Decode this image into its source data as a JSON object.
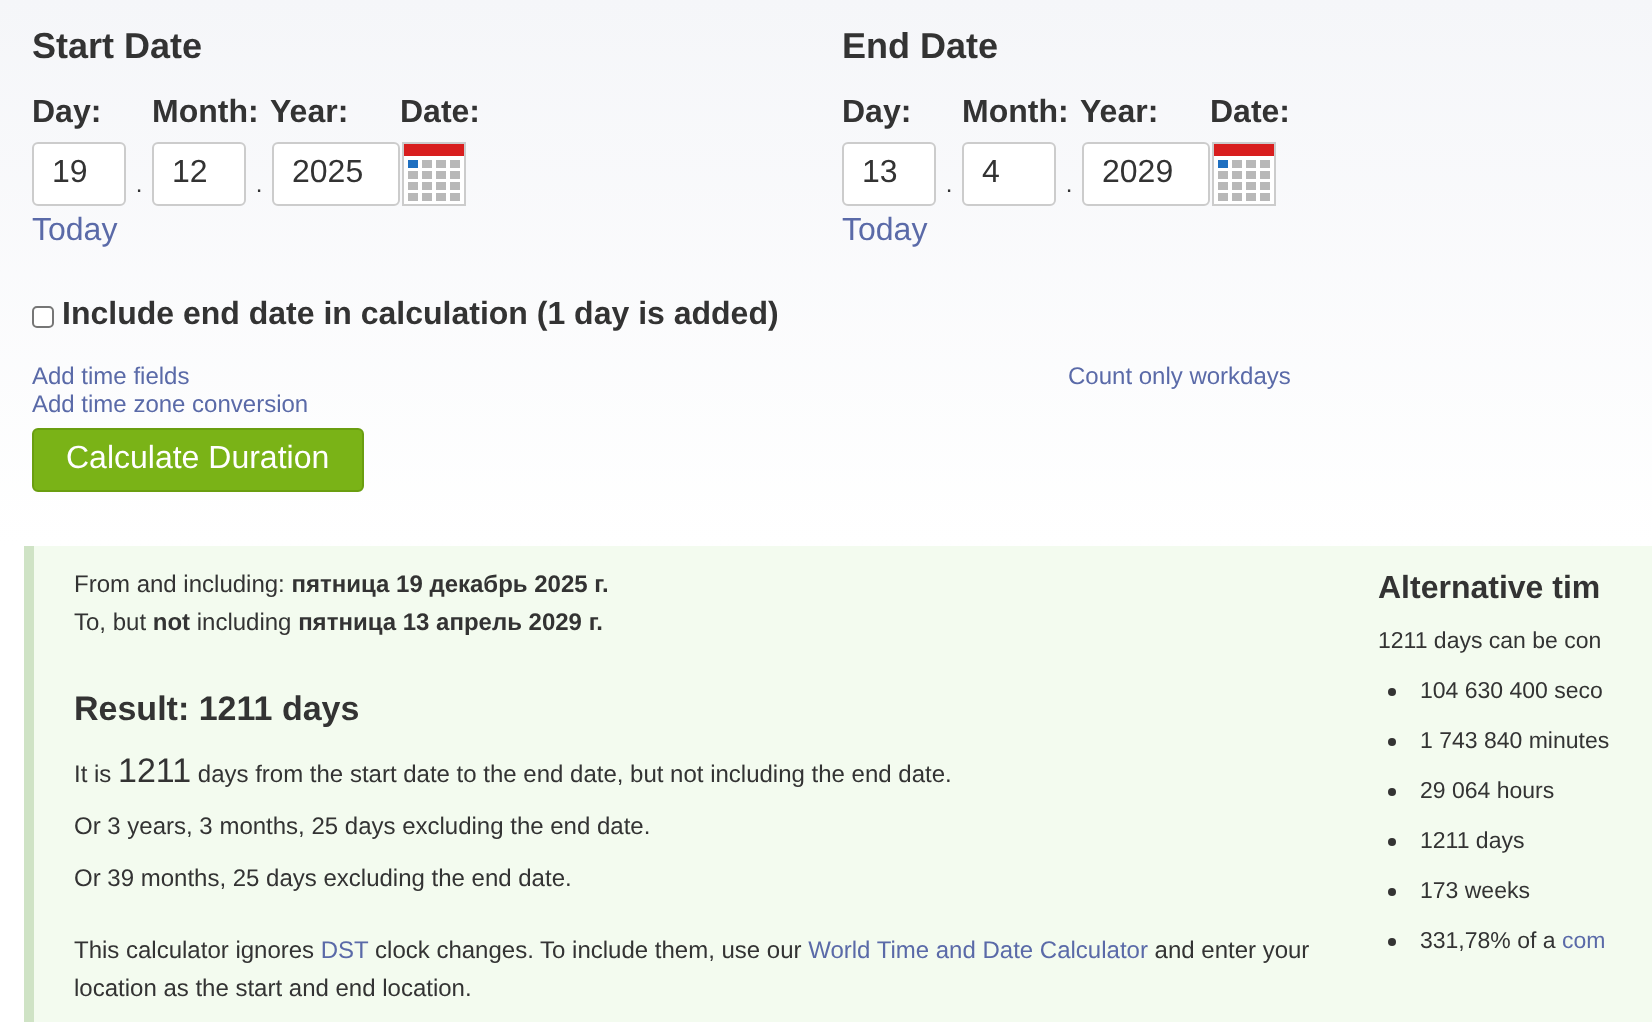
{
  "date_panels": [
    {
      "title": "Start Date",
      "labels": [
        "Day:",
        "Month:",
        "Year:",
        "Date:"
      ],
      "day": "19",
      "month": "12",
      "year": "2025",
      "separator": ".",
      "today_link": "Today"
    },
    {
      "title": "End Date",
      "labels": [
        "Day:",
        "Month:",
        "Year:",
        "Date:"
      ],
      "day": "13",
      "month": "4",
      "year": "2029",
      "separator": ".",
      "today_link": "Today"
    }
  ],
  "include_end_date": {
    "label": "Include end date in calculation (1 day is added)",
    "checked": false
  },
  "left_links": [
    "Add time fields",
    "Add time zone conversion"
  ],
  "right_links": [
    "Count only workdays"
  ],
  "calculate_button": "Calculate Duration",
  "result": {
    "from_line": "From and including: **пятница 19 декабрь 2025 г.**",
    "to_line": "To, but **not** including **пятница 13 апрель 2029 г.**",
    "heading": "Result: 1211 days",
    "summary": [
      {
        "text": "It is "
      },
      {
        "text": "1211",
        "big": true
      },
      {
        "text": " days from the start date to the end date, but not including the end date."
      }
    ],
    "lines": [
      "Or 3 years, 3 months, 25 days excluding the end date.",
      "Or 39 months, 25 days excluding the end date."
    ],
    "note": [
      {
        "text": "This calculator ignores "
      },
      {
        "text": "DST",
        "link": true
      },
      {
        "text": " clock changes. To include them, use our "
      },
      {
        "text": "World Time and Date Calculator",
        "link": true
      },
      {
        "text": " and enter your location as the start and end location."
      }
    ]
  },
  "alternative": {
    "heading": "Alternative tim",
    "intro": "1211 days can be con",
    "items": [
      [
        {
          "text": "104 630 400 seco"
        }
      ],
      [
        {
          "text": "1 743 840 minutes"
        }
      ],
      [
        {
          "text": "29 064 hours"
        }
      ],
      [
        {
          "text": "1211 days"
        }
      ],
      [
        {
          "text": "173 weeks"
        }
      ],
      [
        {
          "text": "331,78% of a "
        },
        {
          "text": "com",
          "link": true
        }
      ]
    ]
  }
}
